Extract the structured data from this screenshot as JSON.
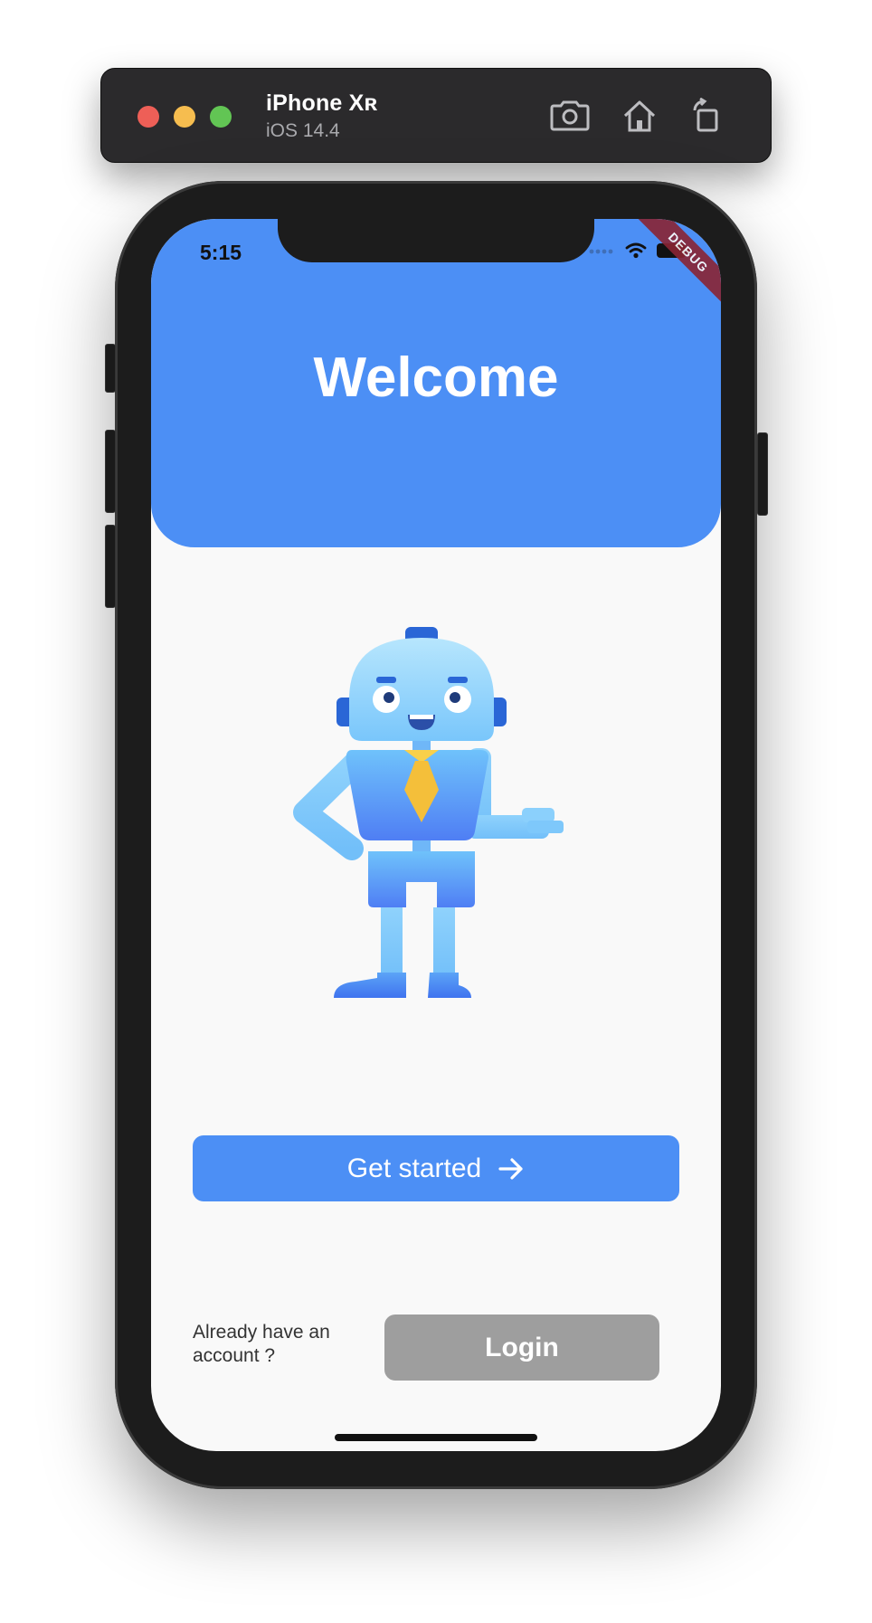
{
  "simulator": {
    "device_name": "iPhone Xʀ",
    "os_version": "iOS 14.4",
    "colors": {
      "close": "#ee5f57",
      "minimize": "#f6bd4f",
      "zoom": "#62c554"
    },
    "icons": [
      "screenshot-icon",
      "home-icon",
      "rotate-icon"
    ]
  },
  "status_bar": {
    "time": "5:15",
    "icons": [
      "signal-icon",
      "wifi-icon",
      "battery-icon"
    ]
  },
  "debug_banner": "DEBUG",
  "header": {
    "title": "Welcome",
    "background": "#4c8ff5"
  },
  "illustration": {
    "icon": "robot-illustration"
  },
  "get_started": {
    "label": "Get started",
    "icon": "arrow-right-icon",
    "background": "#4c8ff5"
  },
  "login_prompt": {
    "text": "Already have an account ?",
    "login_label": "Login",
    "login_background": "#9e9e9e"
  }
}
